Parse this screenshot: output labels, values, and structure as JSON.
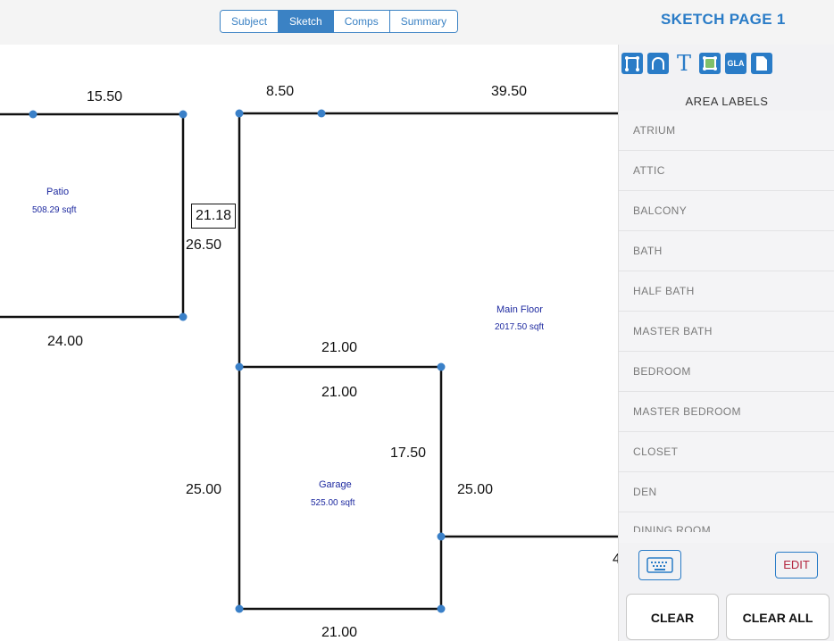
{
  "tabs": [
    {
      "label": "Subject",
      "active": false
    },
    {
      "label": "Sketch",
      "active": true
    },
    {
      "label": "Comps",
      "active": false
    },
    {
      "label": "Summary",
      "active": false
    }
  ],
  "page_title": "SKETCH PAGE 1",
  "tools": {
    "text_tool": "T",
    "gla_tool": "GLA"
  },
  "panel": {
    "header": "AREA LABELS",
    "labels": [
      "ATRIUM",
      "ATTIC",
      "BALCONY",
      "BATH",
      "HALF BATH",
      "MASTER BATH",
      "BEDROOM",
      "MASTER BEDROOM",
      "CLOSET",
      "DEN",
      "DINING ROOM"
    ],
    "edit_label": "EDIT",
    "clear_label": "CLEAR",
    "clear_all_label": "CLEAR ALL"
  },
  "sketch": {
    "dimensions": {
      "patio_top": "15.50",
      "patio_bottom": "24.00",
      "main_top_left": "8.50",
      "main_top_right": "39.50",
      "selected_segment": "21.18",
      "left_side": "26.50",
      "garage_top_outer": "21.00",
      "garage_top_inner": "21.00",
      "garage_right_inner": "17.50",
      "garage_left": "25.00",
      "garage_right_outer": "25.00",
      "garage_bottom": "21.00",
      "cut_off_right": "4"
    },
    "areas": {
      "patio": {
        "name": "Patio",
        "size": "508.29 sqft"
      },
      "main": {
        "name": "Main Floor",
        "size": "2017.50 sqft"
      },
      "garage": {
        "name": "Garage",
        "size": "525.00 sqft"
      }
    }
  },
  "colors": {
    "accent": "#2a7cc7",
    "vertex": "#3a80c8",
    "area_label": "#1e2aa0",
    "edit_text": "#b3253e"
  }
}
